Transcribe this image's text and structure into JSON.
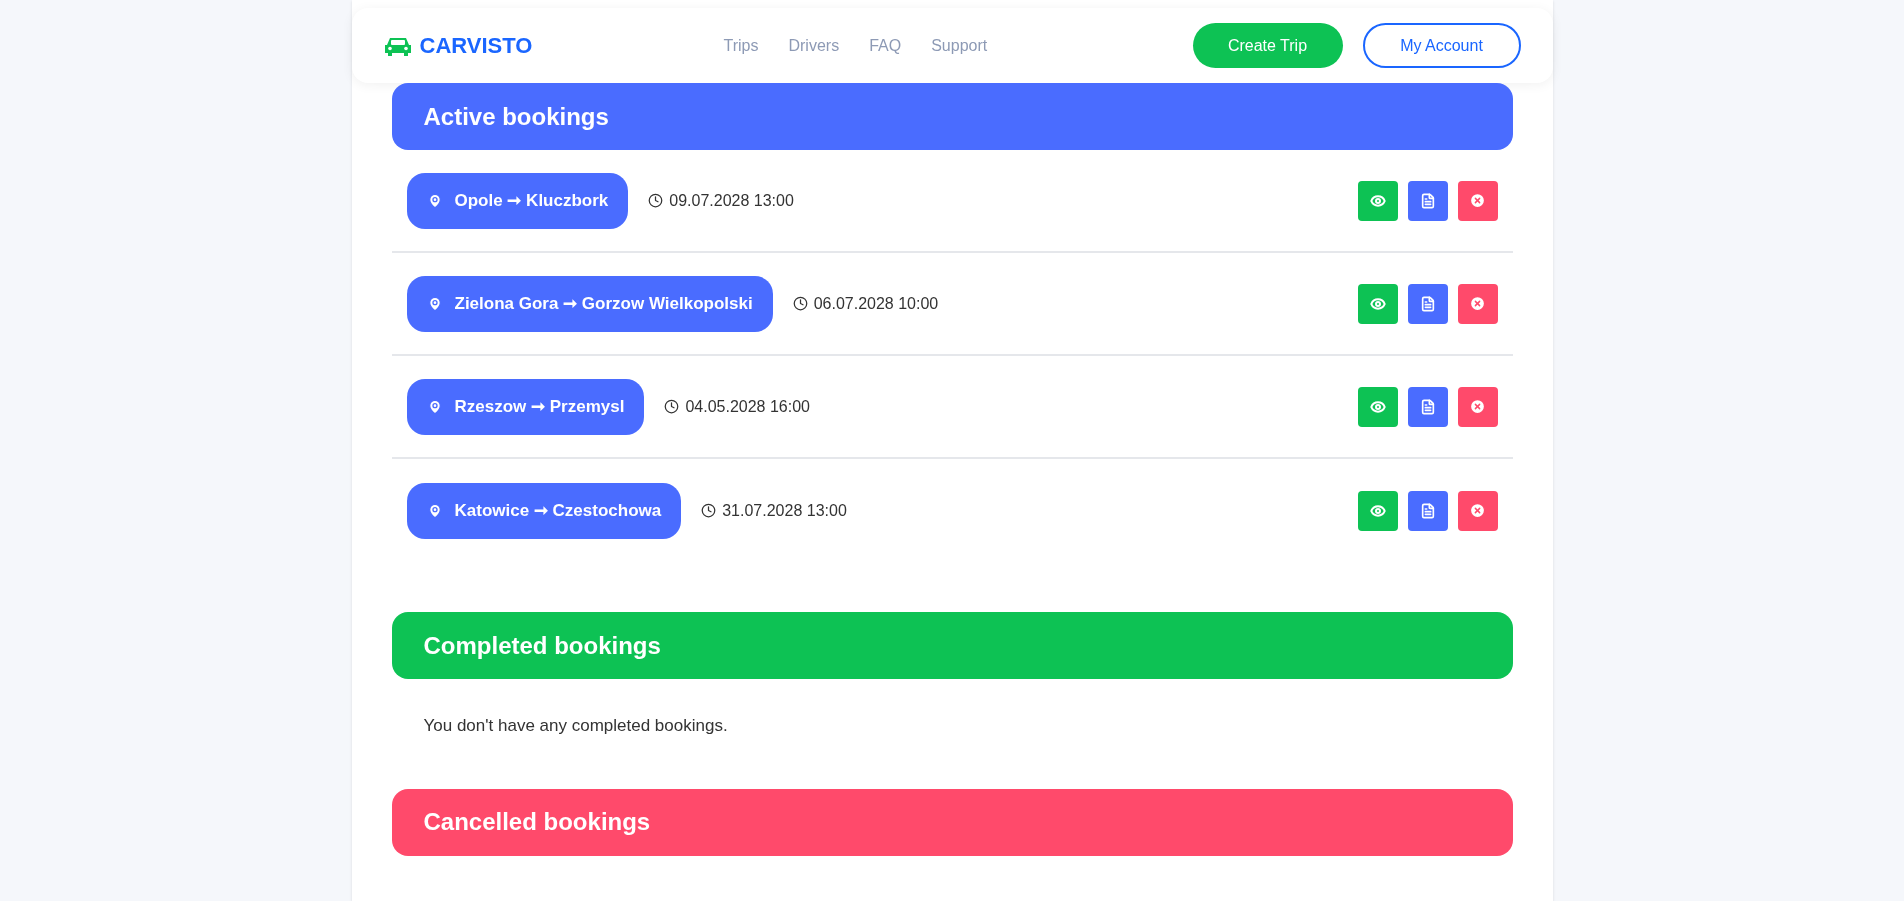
{
  "navbar": {
    "brand": "CARVISTO",
    "links": [
      "Trips",
      "Drivers",
      "FAQ",
      "Support"
    ],
    "primary_button": "Create Trip",
    "secondary_button": "My Account"
  },
  "sections": [
    {
      "title": "Active bookings",
      "color": "#4a6cff",
      "bookings": [
        {
          "route": "Opole ➞ Kluczbork",
          "datetime": "09.07.2028 13:00"
        },
        {
          "route": "Zielona Gora ➞ Gorzow Wielkopolski",
          "datetime": "06.07.2028 10:00"
        },
        {
          "route": "Rzeszow ➞ Przemysl",
          "datetime": "04.05.2028 16:00"
        },
        {
          "route": "Katowice ➞ Czestochowa",
          "datetime": "31.07.2028 13:00"
        }
      ]
    },
    {
      "title": "Completed bookings",
      "color": "#0dc254",
      "empty_message": "You don't have any completed bookings."
    },
    {
      "title": "Cancelled bookings",
      "color": "#ff4a6b"
    }
  ]
}
